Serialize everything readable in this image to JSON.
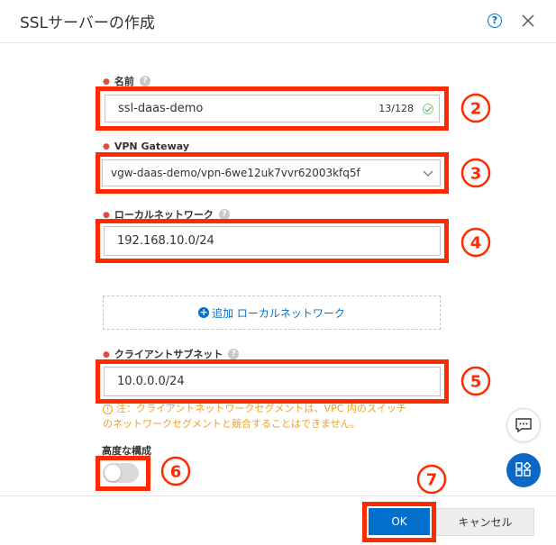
{
  "dialog": {
    "title": "SSLサーバーの作成",
    "help_icon": "question-circle-icon",
    "close_icon": "close-icon"
  },
  "fields": {
    "name": {
      "label": "名前",
      "value": "ssl-daas-demo",
      "counter": "13/128"
    },
    "vpn_gateway": {
      "label": "VPN Gateway",
      "value": "vgw-daas-demo/vpn-6we12uk7vvr62003kfq5f"
    },
    "local_network": {
      "label": "ローカルネットワーク",
      "value": "192.168.10.0/24"
    },
    "add_local_network": {
      "label": "追加 ローカルネットワーク"
    },
    "client_subnet": {
      "label": "クライアントサブネット",
      "value": "10.0.0.0/24",
      "warning_line1": "注：クライアントネットワークセグメントは、VPC 内のスイッチ",
      "warning_line2": "のネットワークセグメントと競合することはできません。"
    },
    "advanced": {
      "label": "高度な構成",
      "enabled": false
    }
  },
  "footer": {
    "ok_label": "OK",
    "cancel_label": "キャンセル"
  },
  "annotations": {
    "color": "#ff2a00",
    "numbers": [
      "②",
      "③",
      "④",
      "⑤",
      "⑥",
      "⑦"
    ]
  },
  "colors": {
    "primary": "#0070cc",
    "required_dot": "#e04a3f",
    "warning": "#f0a020",
    "valid": "#47a95f"
  },
  "floating_buttons": [
    "chat-icon",
    "apps-icon"
  ]
}
